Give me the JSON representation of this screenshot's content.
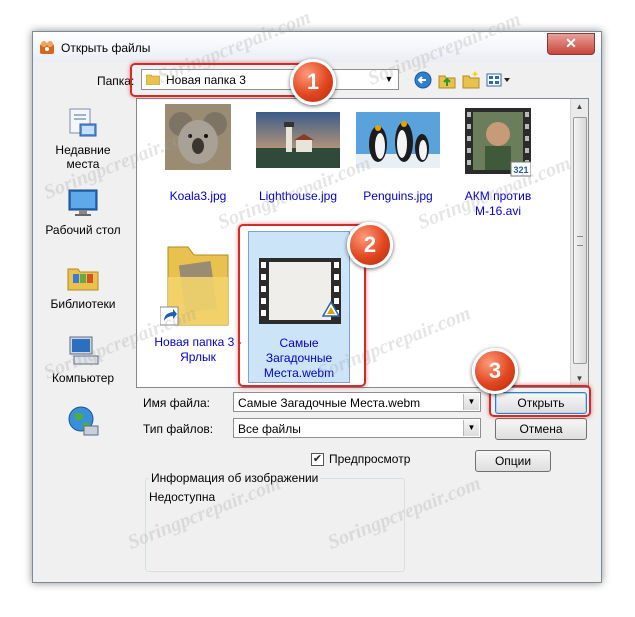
{
  "window": {
    "title": "Открыть файлы",
    "close_symbol": "✕"
  },
  "folder_bar": {
    "label": "Папка:",
    "current": "Новая папка 3",
    "dropdown_symbol": "▼"
  },
  "toolbar": {
    "icons": [
      "back-icon",
      "up-folder-icon",
      "new-folder-icon",
      "view-menu-icon"
    ]
  },
  "places": [
    {
      "name": "recent-places",
      "label_line1": "Недавние",
      "label_line2": "места"
    },
    {
      "name": "desktop",
      "label_line1": "Рабочий стол",
      "label_line2": ""
    },
    {
      "name": "libraries",
      "label_line1": "Библиотеки",
      "label_line2": ""
    },
    {
      "name": "computer",
      "label_line1": "Компьютер",
      "label_line2": ""
    },
    {
      "name": "network",
      "label_line1": "",
      "label_line2": ""
    }
  ],
  "files": [
    {
      "name": "Koala3.jpg",
      "line2": "",
      "line3": ""
    },
    {
      "name": "Lighthouse.jpg",
      "line2": "",
      "line3": ""
    },
    {
      "name": "Penguins.jpg",
      "line2": "",
      "line3": ""
    },
    {
      "name": "АКМ против",
      "line2": "M-16.avi",
      "line3": ""
    },
    {
      "name": "Новая папка 3 -",
      "line2": "Ярлык",
      "line3": ""
    },
    {
      "name": "Самые",
      "line2": "Загадочные",
      "line3": "Места.webm"
    }
  ],
  "filename_field": {
    "label": "Имя файла:",
    "value": "Самые Загадочные Места.webm"
  },
  "filetype_field": {
    "label": "Тип файлов:",
    "value": "Все файлы"
  },
  "buttons": {
    "open": "Открыть",
    "cancel": "Отмена",
    "options": "Опции"
  },
  "preview": {
    "label": "Предпросмотр",
    "checked": true,
    "check_symbol": "✔"
  },
  "image_info": {
    "title": "Информация об изображении",
    "value": "Недоступна"
  },
  "watermark": "Soringpcrepair.com",
  "step_badges": [
    "1",
    "2",
    "3"
  ],
  "colors": {
    "marker": "#d22b2b",
    "badge": "#e0461f",
    "selection": "#cce4f7",
    "link_text": "#0000cc"
  }
}
